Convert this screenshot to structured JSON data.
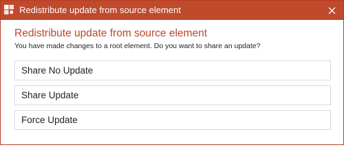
{
  "window": {
    "title": "Redistribute update from source element",
    "icon": "app-logo-icon",
    "close_icon": "close-icon",
    "accent_color": "#bf4a2c"
  },
  "dialog": {
    "heading": "Redistribute update from source element",
    "message": "You have made changes to a root element. Do you want to share an update?"
  },
  "options": [
    {
      "label": "Share No Update"
    },
    {
      "label": "Share Update"
    },
    {
      "label": "Force Update"
    }
  ]
}
